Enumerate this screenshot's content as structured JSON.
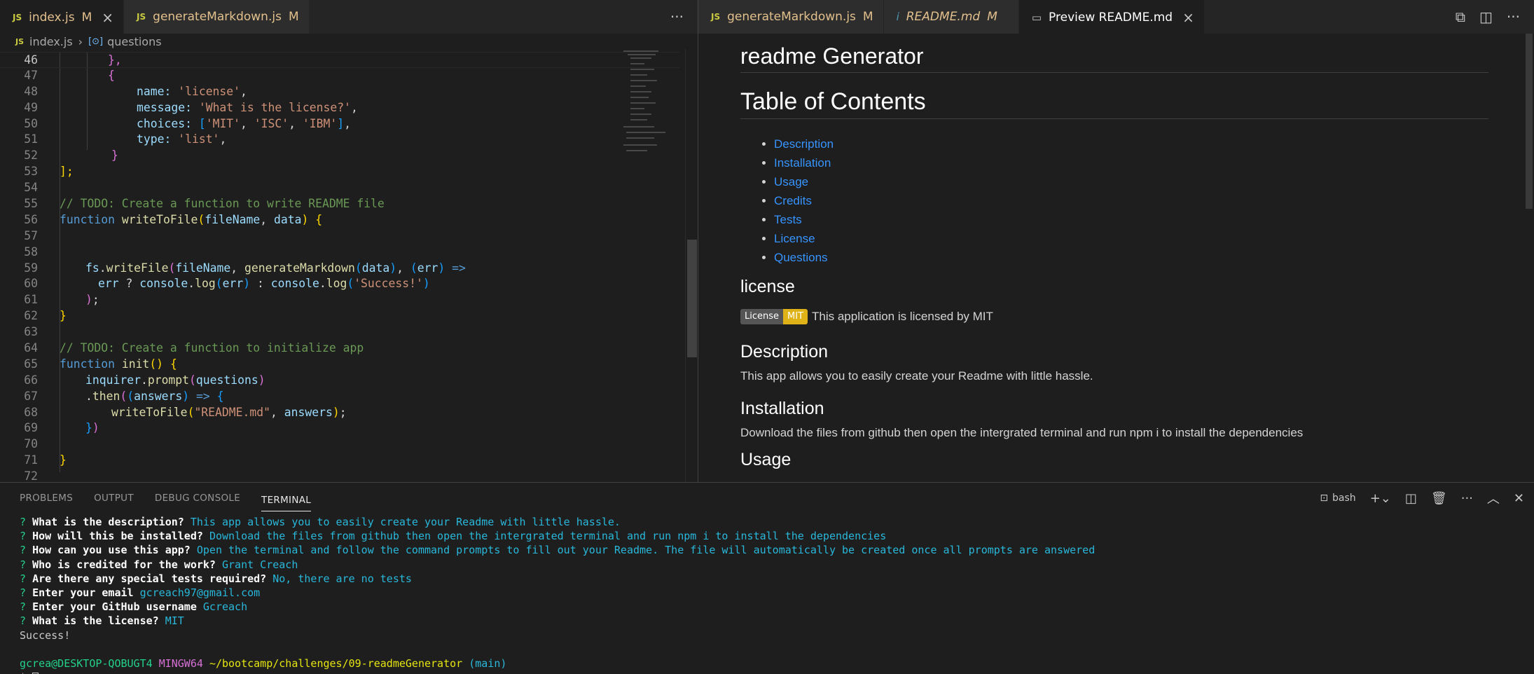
{
  "left_tabs": [
    {
      "icon": "JS",
      "name": "index.js",
      "status": "M"
    },
    {
      "icon": "JS",
      "name": "generateMarkdown.js",
      "status": "M"
    }
  ],
  "left_more": "···",
  "breadcrumb": {
    "file": "index.js",
    "symbol": "questions"
  },
  "code": [
    {
      "n": "46"
    },
    {
      "n": "47"
    },
    {
      "n": "48"
    },
    {
      "n": "49"
    },
    {
      "n": "50"
    },
    {
      "n": "51"
    },
    {
      "n": "52"
    },
    {
      "n": "53"
    },
    {
      "n": "54"
    },
    {
      "n": "55"
    },
    {
      "n": "56"
    },
    {
      "n": "57"
    },
    {
      "n": "58"
    },
    {
      "n": "59"
    },
    {
      "n": "60"
    },
    {
      "n": "61"
    },
    {
      "n": "62"
    },
    {
      "n": "63"
    },
    {
      "n": "64"
    },
    {
      "n": "65"
    },
    {
      "n": "66"
    },
    {
      "n": "67"
    },
    {
      "n": "68"
    },
    {
      "n": "69"
    },
    {
      "n": "70"
    },
    {
      "n": "71"
    },
    {
      "n": "72"
    }
  ],
  "code_text": {
    "l46": "},",
    "l47": "{",
    "l48_key": "name:",
    "l48_val": "'license'",
    "l49_key": "message:",
    "l49_val": "'What is the license?'",
    "l50_key": "choices:",
    "l50_a": "'MIT'",
    "l50_b": "'ISC'",
    "l50_c": "'IBM'",
    "l51_key": "type:",
    "l51_val": "'list'",
    "l52": "}",
    "l53": "];",
    "l55": "// TODO: Create a function to write README file",
    "l56_kw": "function",
    "l56_fn": "writeToFile",
    "l56_a": "fileName",
    "l56_b": "data",
    "l59_obj": "fs",
    "l59_fn": "writeFile",
    "l59_a": "fileName",
    "l59_fn2": "generateMarkdown",
    "l59_b": "data",
    "l59_c": "err",
    "l60_a": "err",
    "l60_obj": "console",
    "l60_fn": "log",
    "l60_b": "err",
    "l60_obj2": "console",
    "l60_fn2": "log",
    "l60_str": "'Success!'",
    "l61": ");",
    "l62": "}",
    "l64": "// TODO: Create a function to initialize app",
    "l65_kw": "function",
    "l65_fn": "init",
    "l66_obj": "inquirer",
    "l66_fn": "prompt",
    "l66_a": "questions",
    "l67_fn": "then",
    "l67_a": "answers",
    "l68_fn": "writeToFile",
    "l68_str": "\"README.md\"",
    "l68_a": "answers",
    "l69": "})",
    "l71": "}"
  },
  "right_tabs": [
    {
      "icon": "JS",
      "name": "generateMarkdown.js",
      "status": "M"
    },
    {
      "icon": "i",
      "name": "README.md",
      "status": "M"
    },
    {
      "icon": "preview",
      "name": "Preview README.md",
      "close": "×"
    }
  ],
  "preview": {
    "title": "readme Generator",
    "toc_title": "Table of Contents",
    "toc": [
      "Description",
      "Installation",
      "Usage",
      "Credits",
      "Tests",
      "License",
      "Questions"
    ],
    "license_heading": "license",
    "badge_left": "License",
    "badge_right": "MIT",
    "license_text": "This application is licensed by MIT",
    "description_heading": "Description",
    "description_text": "This app allows you to easily create your Readme with little hassle.",
    "installation_heading": "Installation",
    "installation_text": "Download the files from github then open the intergrated terminal and run npm i to install the dependencies",
    "usage_heading_partial": "Usage"
  },
  "panel_tabs": [
    "PROBLEMS",
    "OUTPUT",
    "DEBUG CONSOLE",
    "TERMINAL"
  ],
  "panel_shell": "bash",
  "terminal": {
    "lines": [
      {
        "q": "What is the description?",
        "a": "This app allows you to easily create your Readme with little hassle."
      },
      {
        "q": "How will this be installed?",
        "a": "Download the files from github then open the intergrated terminal and run npm i to install the dependencies"
      },
      {
        "q": "How can you use this app?",
        "a": "Open the terminal and follow the command prompts to fill out your Readme. The file will automatically be created once all prompts are answered"
      },
      {
        "q": "Who is credited for the work?",
        "a": "Grant Creach"
      },
      {
        "q": "Are there any special tests required?",
        "a": "No, there are no tests"
      },
      {
        "q": "Enter your email",
        "a": "gcreach97@gmail.com"
      },
      {
        "q": "Enter your GitHub username",
        "a": "Gcreach"
      },
      {
        "q": "What is the license?",
        "a": "MIT"
      }
    ],
    "success": "Success!",
    "prompt_user": "gcrea@DESKTOP-QOBUGT4",
    "prompt_env": "MINGW64",
    "prompt_path": "~/bootcamp/challenges/09-readmeGenerator",
    "prompt_branch": "(main)",
    "prompt_symbol": "$"
  },
  "colors": {
    "accent_link": "#3794ff",
    "modified": "#e2c08d",
    "terminal_green": "#23d18b",
    "terminal_cyan": "#29b8db"
  }
}
